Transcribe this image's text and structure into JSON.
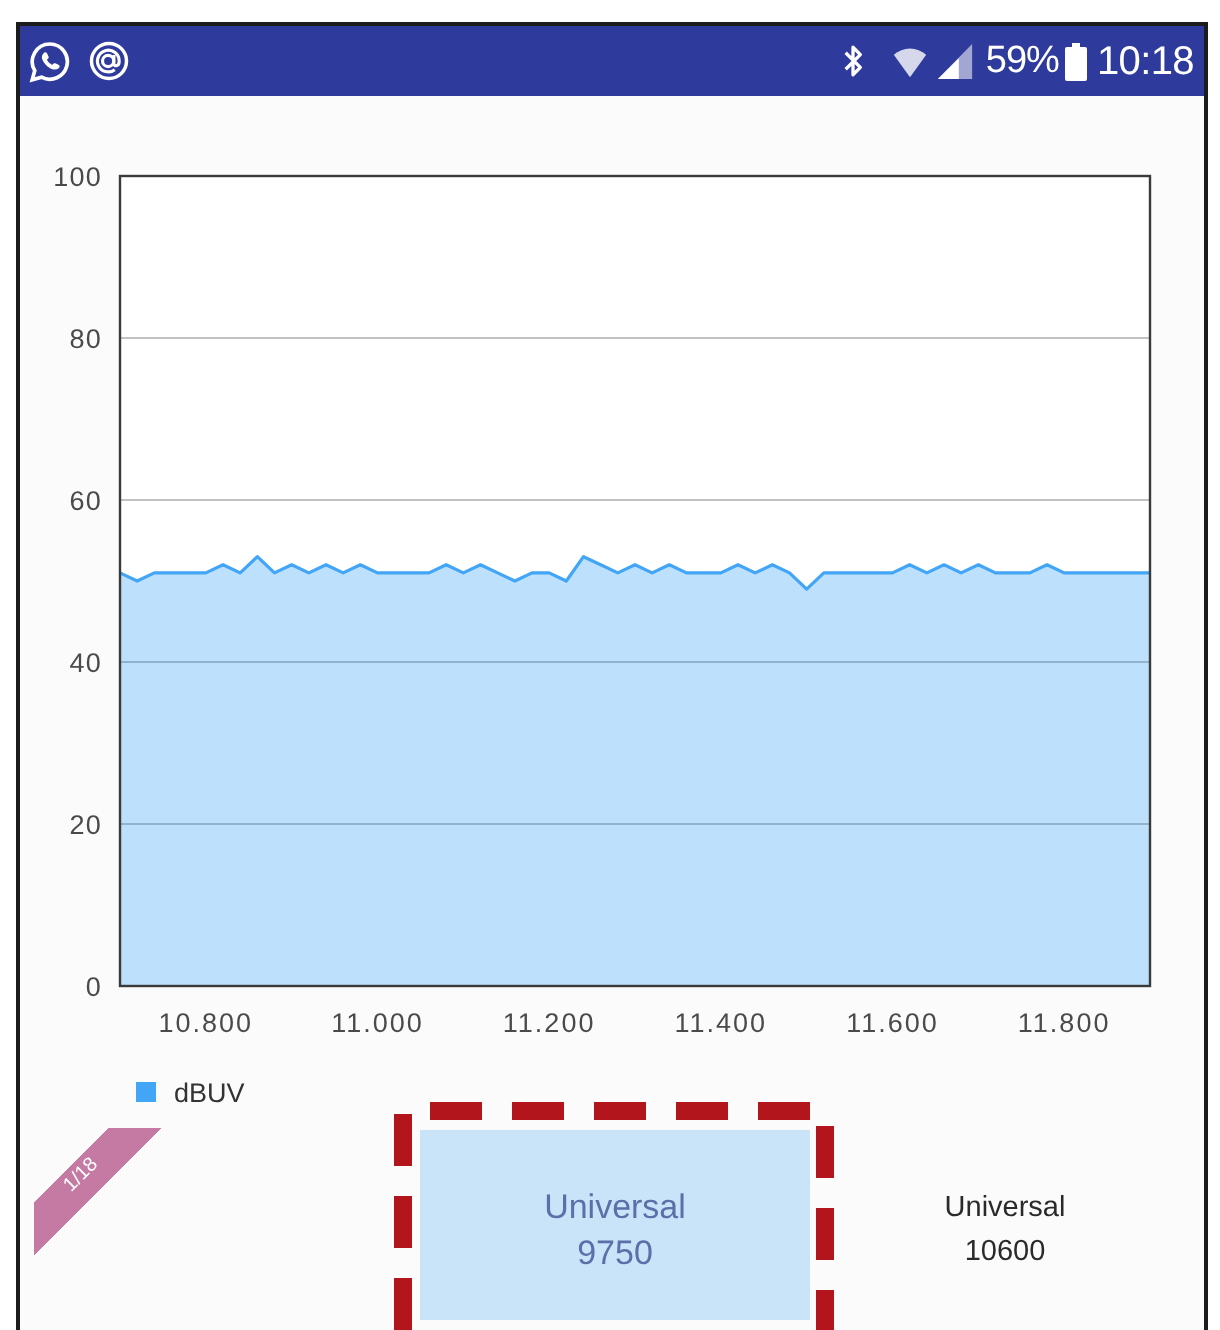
{
  "status_bar": {
    "battery_percent": "59%",
    "time": "10:18"
  },
  "chart": {
    "chart_data": {
      "type": "area",
      "x": [
        10.7,
        10.72,
        10.74,
        10.76,
        10.78,
        10.8,
        10.82,
        10.84,
        10.86,
        10.88,
        10.9,
        10.92,
        10.94,
        10.96,
        10.98,
        11,
        11.02,
        11.04,
        11.06,
        11.08,
        11.1,
        11.12,
        11.14,
        11.16,
        11.18,
        11.2,
        11.22,
        11.24,
        11.26,
        11.28,
        11.3,
        11.32,
        11.34,
        11.36,
        11.38,
        11.4,
        11.42,
        11.44,
        11.46,
        11.48,
        11.5,
        11.52,
        11.54,
        11.56,
        11.58,
        11.6,
        11.62,
        11.64,
        11.66,
        11.68,
        11.7,
        11.72,
        11.74,
        11.76,
        11.78,
        11.8,
        11.82,
        11.84,
        11.86,
        11.88,
        11.9
      ],
      "series": [
        {
          "name": "dBUV",
          "color": "#42a5f5",
          "values": [
            51,
            50,
            51,
            51,
            51,
            51,
            52,
            51,
            53,
            51,
            52,
            51,
            52,
            51,
            52,
            51,
            51,
            51,
            51,
            52,
            51,
            52,
            51,
            50,
            51,
            51,
            50,
            53,
            52,
            51,
            52,
            51,
            52,
            51,
            51,
            51,
            52,
            51,
            52,
            51,
            49,
            51,
            51,
            51,
            51,
            51,
            52,
            51,
            52,
            51,
            52,
            51,
            51,
            51,
            52,
            51,
            51,
            51,
            51,
            51,
            51
          ]
        }
      ],
      "xlim": [
        10.7,
        11.9
      ],
      "ylim": [
        0,
        100
      ],
      "xticks": [
        {
          "value": 10.8,
          "label": "10.800"
        },
        {
          "value": 11,
          "label": "11.000"
        },
        {
          "value": 11.2,
          "label": "11.200"
        },
        {
          "value": 11.4,
          "label": "11.400"
        },
        {
          "value": 11.6,
          "label": "11.600"
        },
        {
          "value": 11.8,
          "label": "11.800"
        }
      ],
      "yticks": [
        0,
        20,
        40,
        60,
        80,
        100
      ],
      "grid": true
    }
  },
  "carousel": {
    "counter": "1/18",
    "items": [
      {
        "title": "Universal",
        "value": "9750",
        "selected": true,
        "highlighted": true
      },
      {
        "title": "Universal",
        "value": "10600",
        "selected": false,
        "highlighted": false
      }
    ]
  }
}
